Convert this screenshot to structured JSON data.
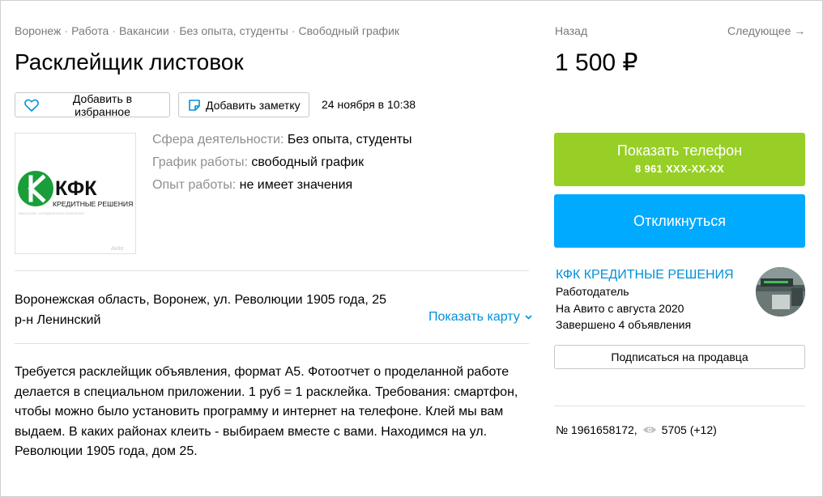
{
  "breadcrumbs": [
    "Воронеж",
    "Работа",
    "Вакансии",
    "Без опыта, студенты",
    "Свободный график"
  ],
  "breadcrumb_separator": "·",
  "title": "Расклейщик листовок",
  "actions": {
    "favorite_label": "Добавить в избранное",
    "note_label": "Добавить заметку",
    "favorite_icon": "heart-icon",
    "note_icon": "note-icon"
  },
  "posted_date": "24 ноября в 10:38",
  "logo": {
    "brand": "КФК",
    "subtitle": "КРЕДИТНЫЕ РЕШЕНИЯ",
    "tagline": "ВАКАНСИИ · ЮРИДИЧЕСКАЯ КОМПАНИЯ",
    "brand_color": "#1a9e3a",
    "watermark": "Avito"
  },
  "params": [
    {
      "key": "Сфера деятельности:",
      "value": "Без опыта, студенты"
    },
    {
      "key": "График работы:",
      "value": "свободный график"
    },
    {
      "key": "Опыт работы:",
      "value": "не имеет значения"
    }
  ],
  "address": {
    "line1": "Воронежская область, Воронеж, ул. Революции 1905 года, 25",
    "line2": "р-н Ленинский",
    "show_map": "Показать карту"
  },
  "description": "Требуется расклейщик объявления, формат А5. Фотоотчет о проделанной работе делается в специальном приложении. 1 руб = 1 расклейка. Требования: смартфон, чтобы можно было установить программу и интернет на телефоне. Клей мы вам выдаем. В каких районах клеить - выбираем вместе с вами. Находимся на ул. Революции 1905 года, дом 25.",
  "nav": {
    "back": "Назад",
    "next": "Следующее →"
  },
  "price": "1 500 ₽",
  "phone_button": {
    "label": "Показать телефон",
    "number": "8 961 XXX-XX-XX",
    "color": "#97cf26"
  },
  "reply_button": {
    "label": "Откликнуться",
    "color": "#00aaff"
  },
  "seller": {
    "name": "КФК КРЕДИТНЫЕ РЕШЕНИЯ",
    "role": "Работодатель",
    "since": "На Авито с августа 2020",
    "completed": "Завершено 4 объявления",
    "subscribe": "Подписаться на продавца"
  },
  "listing_meta": {
    "id": "№ 1961658172,",
    "views": "5705 (+12)",
    "views_icon": "eye-icon"
  },
  "link_color": "#0091d9"
}
